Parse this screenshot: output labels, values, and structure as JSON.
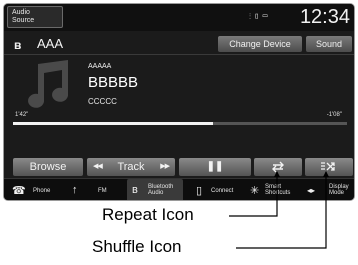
{
  "status_bar": {
    "audio_source_line1": "Audio",
    "audio_source_line2": "Source",
    "status_icons": "⫶ ▯ ▭",
    "clock": "12:34"
  },
  "source_row": {
    "bluetooth_glyph": "ʙ",
    "device_name": "AAA",
    "change_device_label": "Change Device",
    "sound_label": "Sound"
  },
  "now_playing": {
    "album": "AAAAA",
    "title": "BBBBB",
    "artist": "CCCCC",
    "elapsed": "1'42\"",
    "remaining": "-1'08\"",
    "progress": 0.6
  },
  "controls": {
    "browse_label": "Browse",
    "track_label": "Track",
    "track_prev_glyph": "◀◀",
    "track_next_glyph": "▶▶",
    "pause_glyph": "❚❚",
    "repeat_icon": "repeat-icon",
    "shuffle_icon": "shuffle-icon"
  },
  "source_bar": {
    "items": [
      {
        "icon": "☎",
        "label": "Phone"
      },
      {
        "icon": "↑",
        "label": "FM"
      },
      {
        "icon": "ʙ",
        "label_line1": "Bluetooth",
        "label_line2": "Audio"
      },
      {
        "icon": "▯",
        "label": "Connect"
      },
      {
        "icon": "✳",
        "label_line1": "Smart",
        "label_line2": "Shortcuts"
      },
      {
        "icon": "◂▸",
        "label_line1": "Display",
        "label_line2": "Mode"
      }
    ]
  },
  "callouts": {
    "repeat": "Repeat Icon",
    "shuffle": "Shuffle Icon"
  }
}
